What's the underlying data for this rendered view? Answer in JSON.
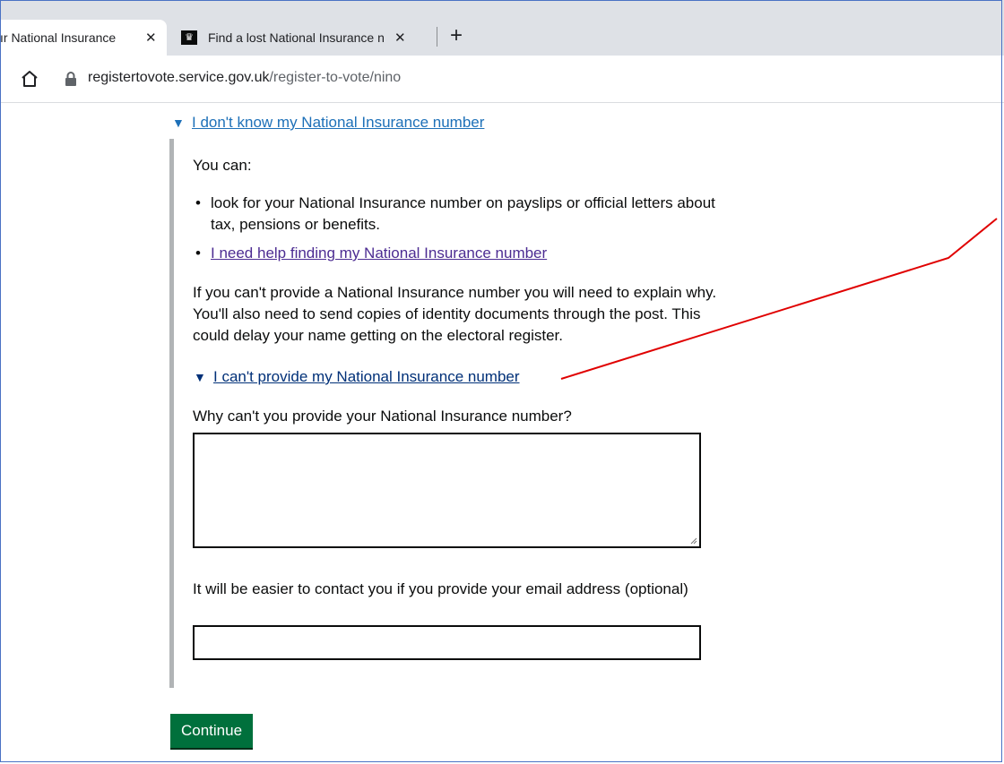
{
  "browser": {
    "tabs": [
      {
        "title": "ır National Insurance ",
        "active": true
      },
      {
        "title": "Find a lost National Insurance nu",
        "active": false
      }
    ],
    "url_domain": "registertovote.service.gov.uk",
    "url_path": "/register-to-vote/nino"
  },
  "page": {
    "details_summary_1": "I don't know my National Insurance number",
    "you_can": "You can:",
    "bullet_1": "look for your National Insurance number on payslips or official letters about tax, pensions or benefits.",
    "bullet_2_link": "I need help finding my National Insurance number",
    "paragraph": "If you can't provide a National Insurance number you will need to explain why. You'll also need to send copies of identity documents through the post. This could delay your name getting on the electoral register.",
    "details_summary_2": "I can't provide my National Insurance number",
    "why_label": "Why can't you provide your National Insurance number?",
    "why_value": "",
    "email_label": "It will be easier to contact you if you provide your email address (optional)",
    "email_value": "",
    "continue_button": "Continue"
  },
  "colors": {
    "link": "#1d70b8",
    "visited_link": "#4c2c92",
    "button": "#00703c",
    "annotation": "#e00000"
  }
}
